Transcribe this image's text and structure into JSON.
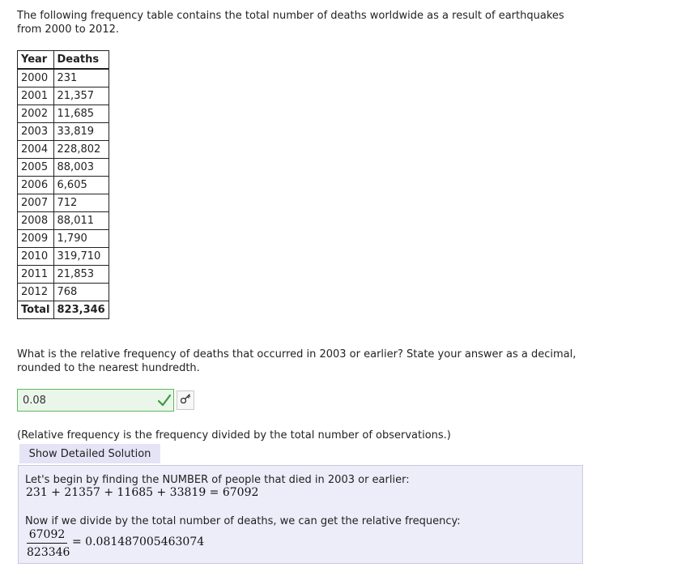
{
  "intro_text": "The following frequency table contains the total number of deaths worldwide as a result of earthquakes from 2000 to 2012.",
  "table": {
    "headers": [
      "Year",
      "Deaths"
    ],
    "rows": [
      [
        "2000",
        "231"
      ],
      [
        "2001",
        "21,357"
      ],
      [
        "2002",
        "11,685"
      ],
      [
        "2003",
        "33,819"
      ],
      [
        "2004",
        "228,802"
      ],
      [
        "2005",
        "88,003"
      ],
      [
        "2006",
        "6,605"
      ],
      [
        "2007",
        "712"
      ],
      [
        "2008",
        "88,011"
      ],
      [
        "2009",
        "1,790"
      ],
      [
        "2010",
        "319,710"
      ],
      [
        "2011",
        "21,853"
      ],
      [
        "2012",
        "768"
      ]
    ],
    "total_label": "Total",
    "total_value": "823,346"
  },
  "question": "What is the relative frequency of deaths that occurred in 2003 or earlier? State your answer as a decimal, rounded to the nearest hundredth.",
  "answer": {
    "value": "0.08",
    "status_icon": "check-icon",
    "status_color": "#3c9a3c",
    "key_icon": "key-icon"
  },
  "hint": "(Relative frequency is the frequency divided by the total number of observations.)",
  "show_solution_label": "Show Detailed Solution",
  "solution": {
    "line1": "Let's begin by finding the NUMBER of people that died in 2003 or earlier:",
    "equation1": "231 + 21357 + 11685 + 33819 = 67092",
    "line2": "Now if we divide by the total number of deaths, we can get the relative frequency:",
    "numerator": "67092",
    "denominator": "823346",
    "result": "= 0.081487005463074"
  },
  "colors": {
    "solution_background": "#ededfa",
    "button_background": "#e4e4f6",
    "input_correct_border": "#5cb85c",
    "input_correct_background": "#eaf6ea"
  }
}
